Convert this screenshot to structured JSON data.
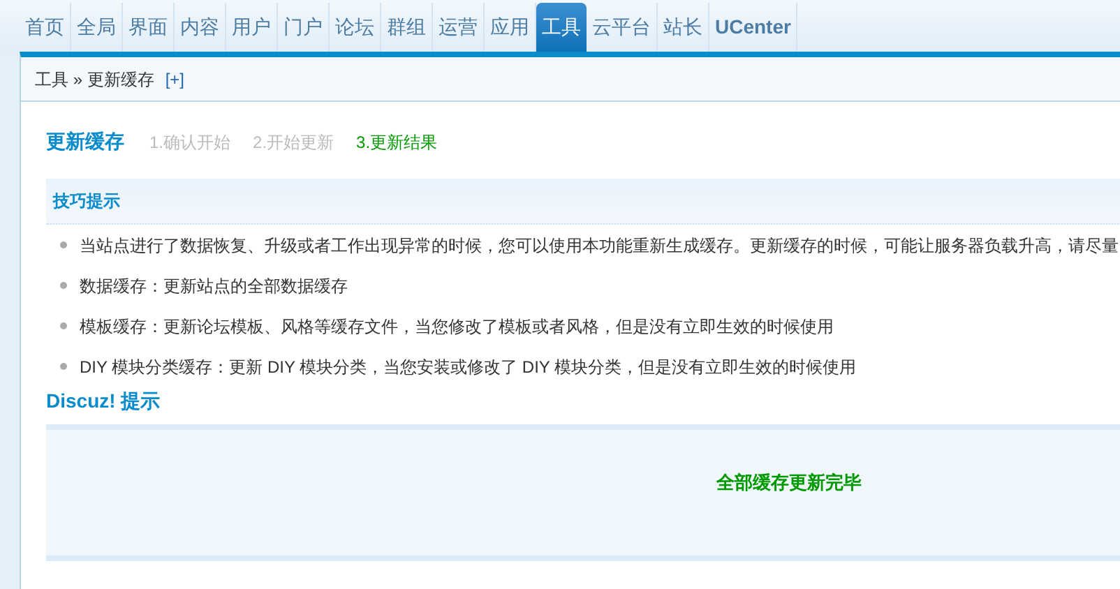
{
  "nav": {
    "tabs": [
      {
        "label": "首页",
        "selected": false
      },
      {
        "label": "全局",
        "selected": false
      },
      {
        "label": "界面",
        "selected": false
      },
      {
        "label": "内容",
        "selected": false
      },
      {
        "label": "用户",
        "selected": false
      },
      {
        "label": "门户",
        "selected": false
      },
      {
        "label": "论坛",
        "selected": false
      },
      {
        "label": "群组",
        "selected": false
      },
      {
        "label": "运营",
        "selected": false
      },
      {
        "label": "应用",
        "selected": false
      },
      {
        "label": "工具",
        "selected": true
      },
      {
        "label": "云平台",
        "selected": false
      },
      {
        "label": "站长",
        "selected": false
      },
      {
        "label": "UCenter",
        "selected": false
      }
    ]
  },
  "breadcrumb": {
    "path": "工具 » 更新缓存",
    "add": "[+]"
  },
  "page": {
    "title": "更新缓存",
    "steps": [
      {
        "label": "1.确认开始",
        "selected": false
      },
      {
        "label": "2.开始更新",
        "selected": false
      },
      {
        "label": "3.更新结果",
        "selected": true
      }
    ]
  },
  "tips": {
    "title": "技巧提示",
    "items": [
      "当站点进行了数据恢复、升级或者工作出现异常的时候，您可以使用本功能重新生成缓存。更新缓存的时候，可能让服务器负载升高，请尽量",
      "数据缓存：更新站点的全部数据缓存",
      "模板缓存：更新论坛模板、风格等缓存文件，当您修改了模板或者风格，但是没有立即生效的时候使用",
      "DIY 模块分类缓存：更新 DIY 模块分类，当您安装或修改了 DIY 模块分类，但是没有立即生效的时候使用"
    ]
  },
  "notice": {
    "title": "Discuz! 提示",
    "message": "全部缓存更新完毕"
  }
}
